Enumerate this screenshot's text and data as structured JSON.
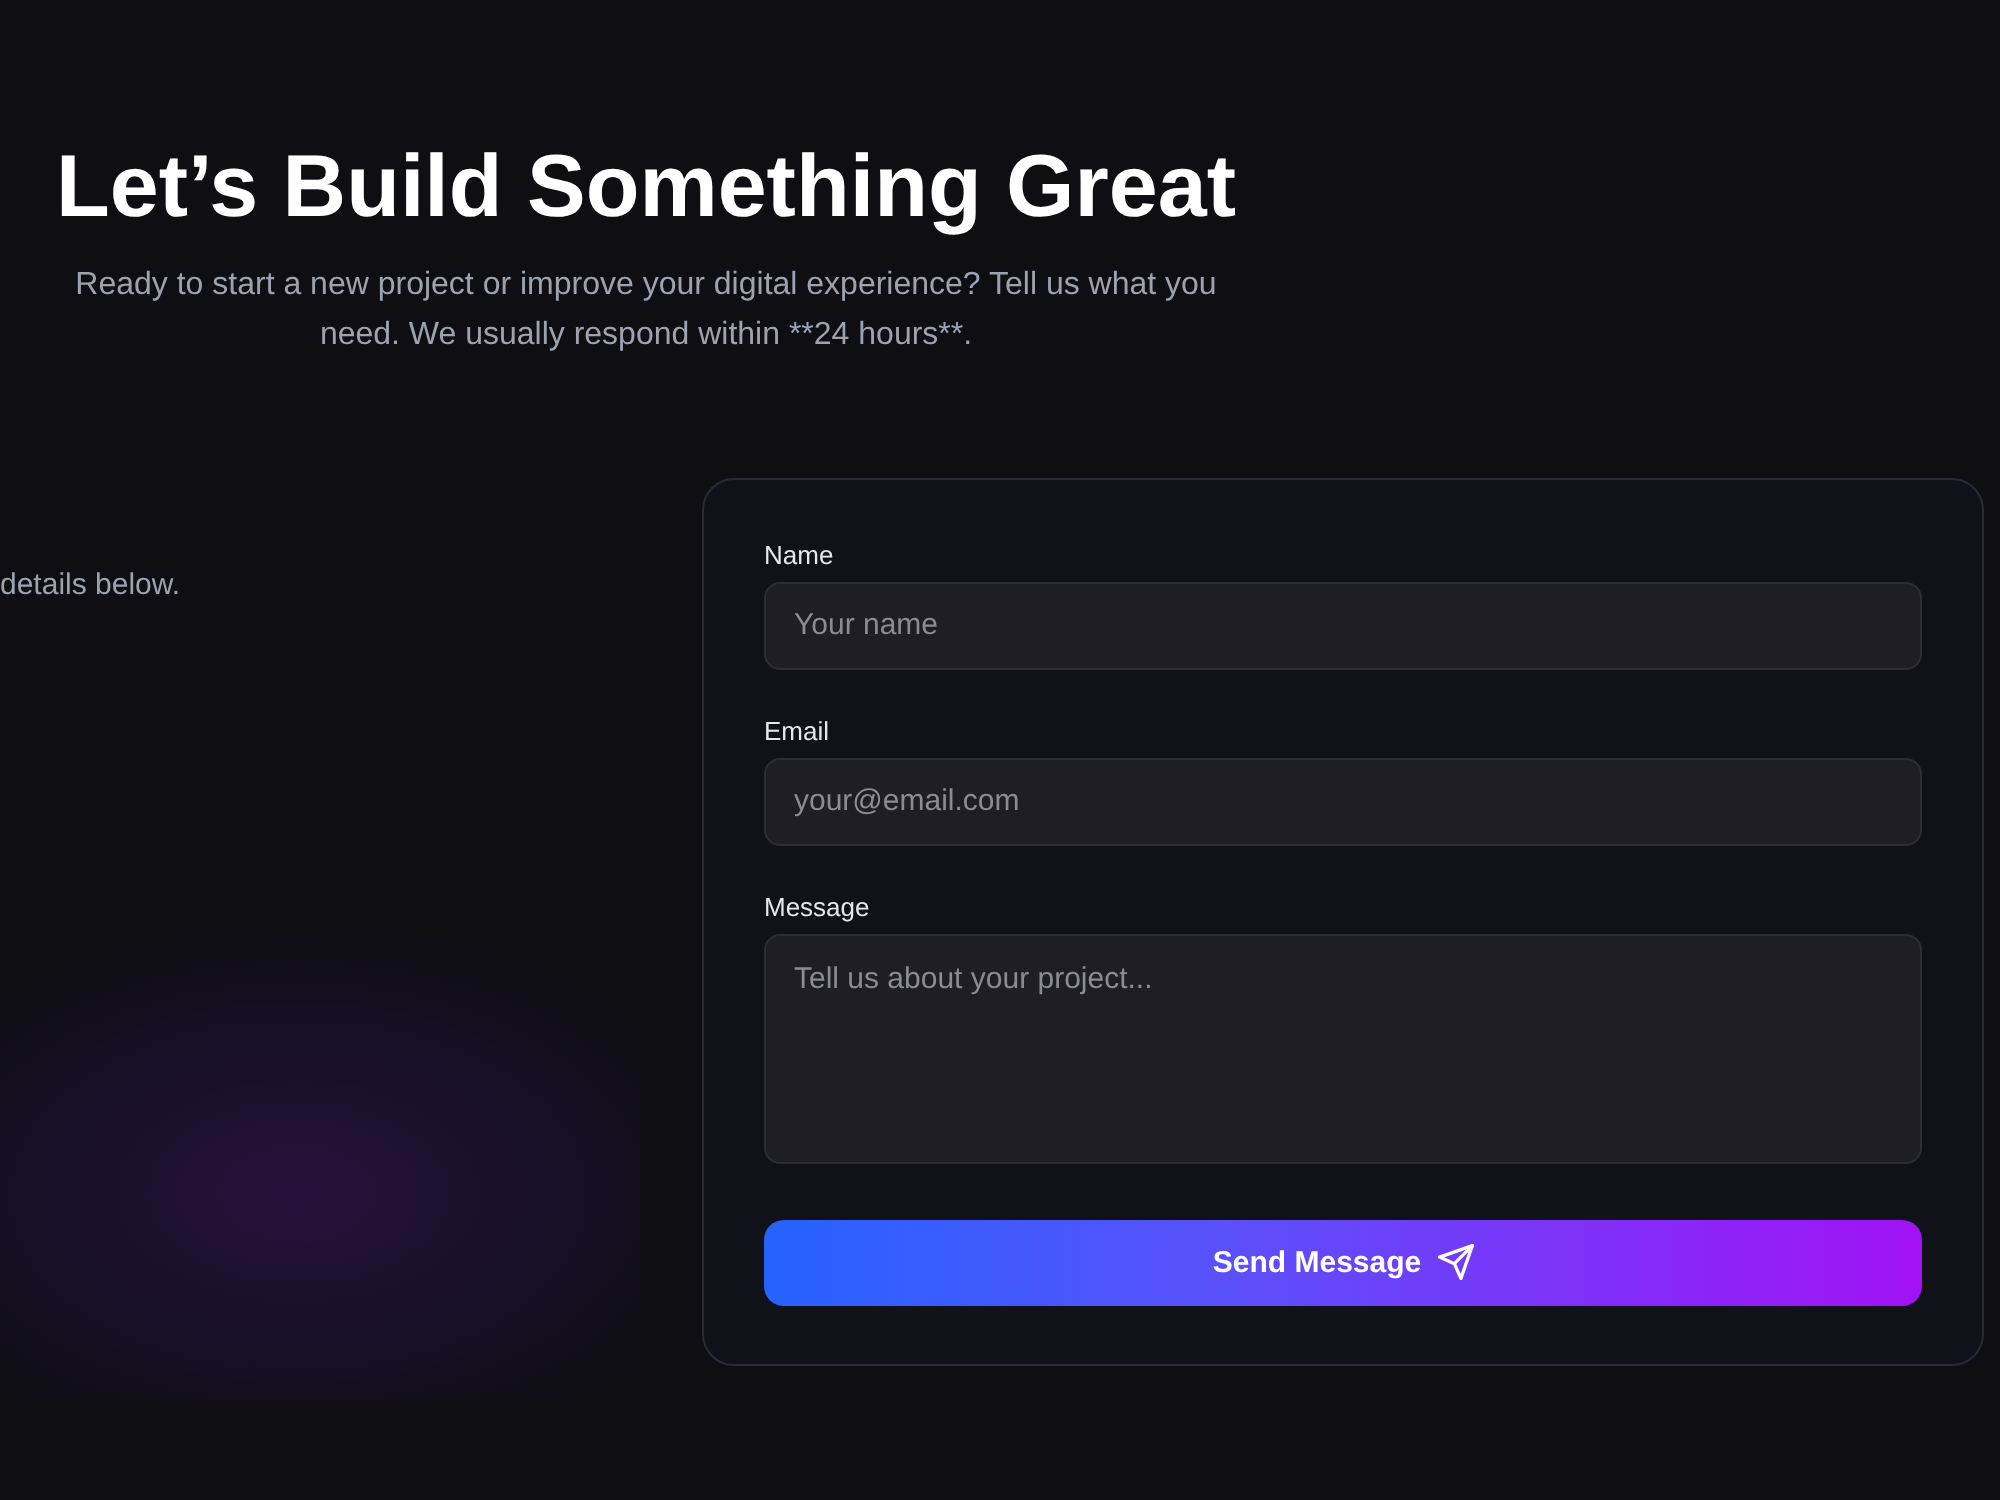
{
  "hero": {
    "title": "Let’s Build Something Great",
    "subtitle": "Ready to start a new project or improve your digital experience? Tell us what you need. We usually respond within **24 hours**."
  },
  "intro": {
    "text": "details below."
  },
  "form": {
    "fields": [
      {
        "kind": "input",
        "label": "Name",
        "placeholder": "Your name"
      },
      {
        "kind": "input",
        "label": "Email",
        "placeholder": "your@email.com"
      },
      {
        "kind": "textarea",
        "label": "Message",
        "placeholder": "Tell us about your project..."
      }
    ],
    "submit": {
      "label": "Send Message"
    }
  }
}
